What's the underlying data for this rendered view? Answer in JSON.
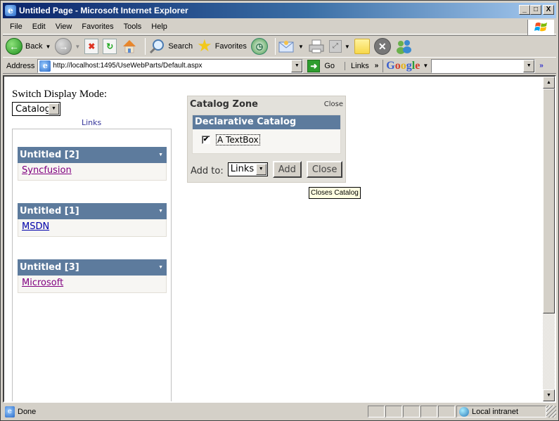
{
  "window": {
    "title": "Untitled Page - Microsoft Internet Explorer",
    "controls": {
      "minimize": "_",
      "maximize": "□",
      "close": "X"
    }
  },
  "menu": {
    "items": [
      {
        "label": "File",
        "accel": "F"
      },
      {
        "label": "Edit",
        "accel": "E"
      },
      {
        "label": "View",
        "accel": "V"
      },
      {
        "label": "Favorites",
        "accel": "a"
      },
      {
        "label": "Tools",
        "accel": "T"
      },
      {
        "label": "Help",
        "accel": "H"
      }
    ]
  },
  "toolbar": {
    "back_label": "Back",
    "search_label": "Search",
    "favorites_label": "Favorites",
    "icons": [
      "back-icon",
      "forward-icon",
      "stop-icon",
      "refresh-icon",
      "home-icon",
      "search-icon",
      "favorites-star-icon",
      "history-icon",
      "mail-icon",
      "print-icon",
      "edit-icon",
      "note-icon",
      "close-circle-icon",
      "messenger-icon"
    ]
  },
  "address": {
    "label": "Address",
    "url": "http://localhost:1495/UseWebParts/Default.aspx",
    "go_label": "Go",
    "links_label": "Links",
    "google_label": "Google",
    "google_search_value": ""
  },
  "page": {
    "mode_label": "Switch Display Mode:",
    "mode_selected": "Catalog",
    "links_zone": {
      "title": "Links",
      "webparts": [
        {
          "title": "Untitled [2]",
          "link": "Syncfusion",
          "visited": true
        },
        {
          "title": "Untitled [1]",
          "link": "MSDN",
          "visited": false
        },
        {
          "title": "Untitled [3]",
          "link": "Microsoft",
          "visited": true
        }
      ]
    },
    "catalog_zone": {
      "title": "Catalog Zone",
      "close_link": "Close",
      "catalog_name": "Declarative Catalog",
      "items": [
        {
          "label": "A TextBox",
          "checked": true
        }
      ],
      "add_to_label": "Add to:",
      "add_to_selected": "Links",
      "add_button": "Add",
      "close_button": "Close",
      "tooltip": "Closes Catalog"
    }
  },
  "status": {
    "text": "Done",
    "zone": "Local intranet"
  },
  "colors": {
    "webpart_header": "#5d7b9d",
    "webpart_body": "#f7f6f3",
    "catalog_bg": "#e3e1db",
    "visited_link": "#800080",
    "link": "#0000aa",
    "zone_title": "#333399"
  }
}
